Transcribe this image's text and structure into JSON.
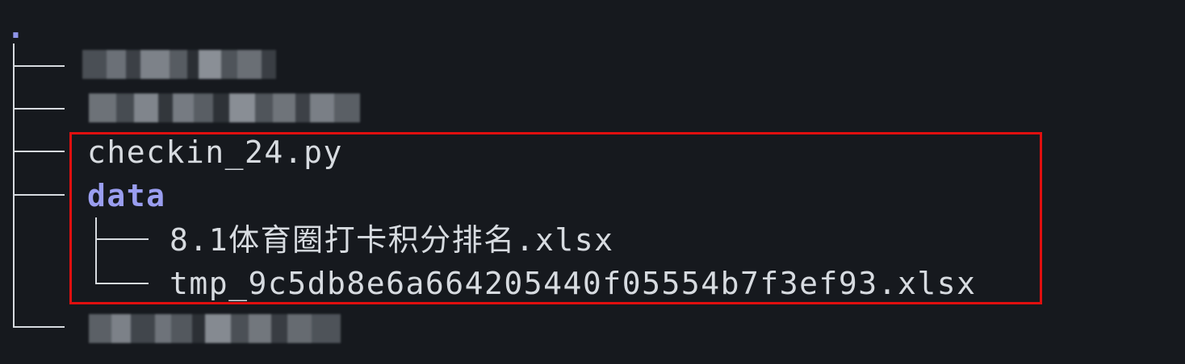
{
  "tree": {
    "root": ".",
    "entries": [
      {
        "name": "checkin_24.py",
        "type": "file"
      },
      {
        "name": "data",
        "type": "directory"
      }
    ],
    "data_children": [
      {
        "name": "8.1体育圈打卡积分排名.xlsx"
      },
      {
        "name": "tmp_9c5db8e6a664205440f05554b7f3ef93.xlsx"
      }
    ]
  },
  "colors": {
    "background": "#16191e",
    "text": "#d7dbe0",
    "directory": "#9a9ef0",
    "highlight": "#e00f0f"
  }
}
